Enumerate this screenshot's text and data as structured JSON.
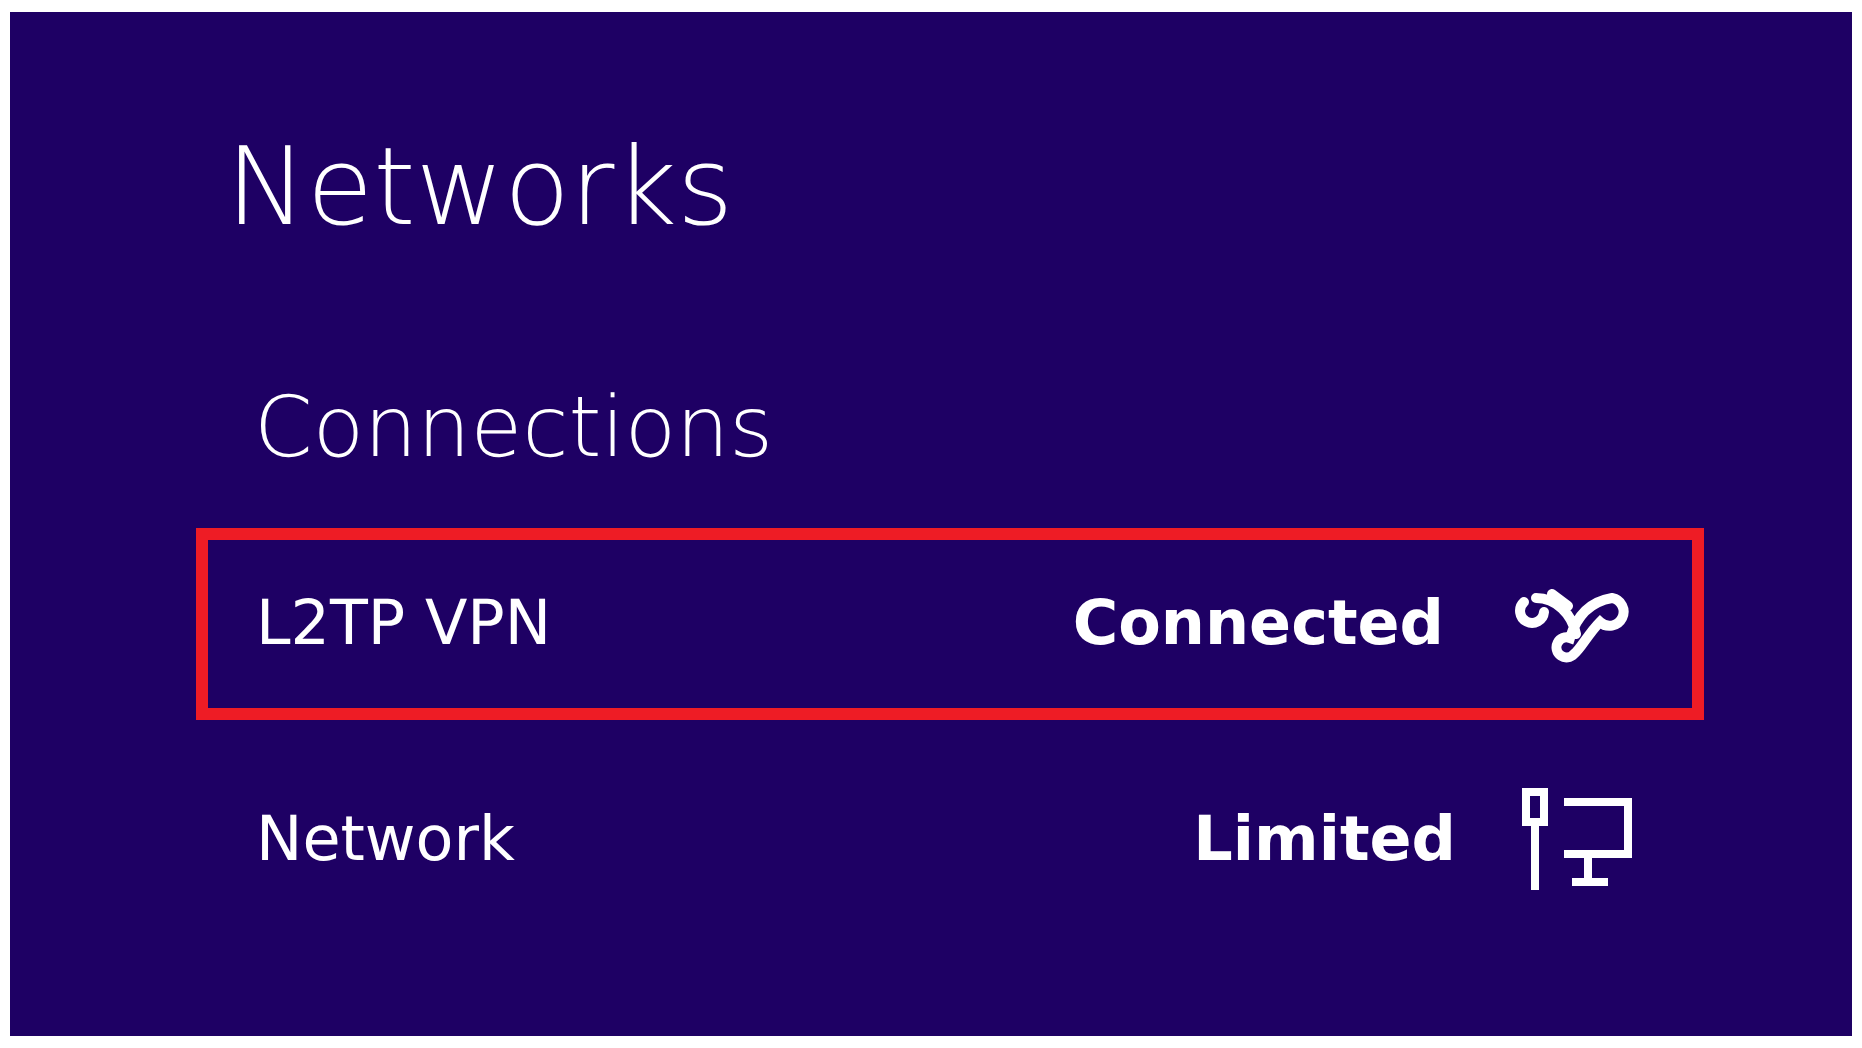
{
  "title": "Networks",
  "section": "Connections",
  "connections": [
    {
      "name": "L2TP VPN",
      "status": "Connected",
      "kind": "vpn",
      "highlighted": true
    },
    {
      "name": "Network",
      "status": "Limited",
      "kind": "ethernet",
      "highlighted": false
    }
  ]
}
